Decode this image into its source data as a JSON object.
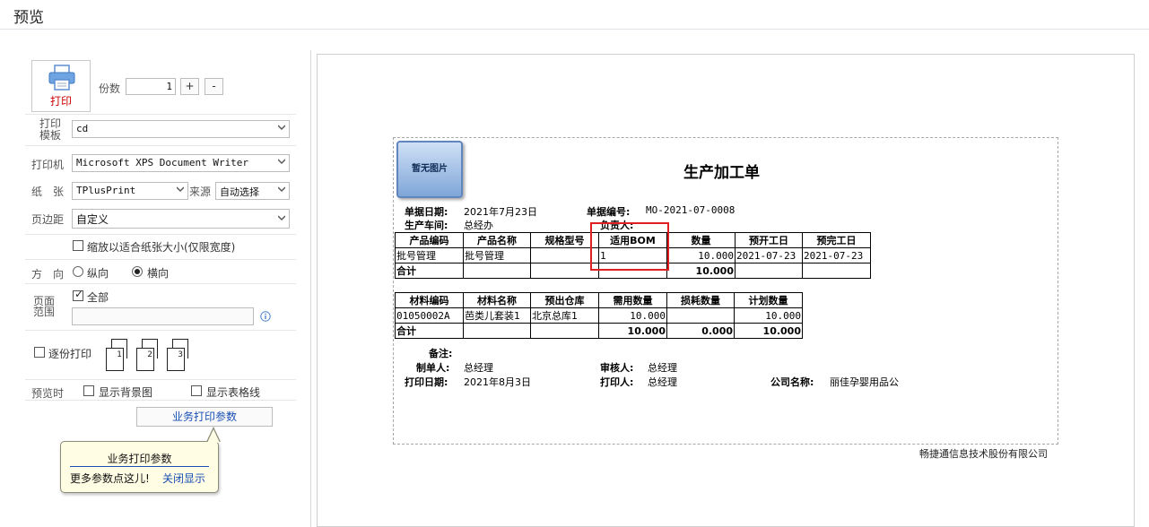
{
  "window": {
    "title": "预览"
  },
  "left": {
    "print_label": "打印",
    "copies_label": "份数",
    "copies_value": "1",
    "plus": "+",
    "minus": "-",
    "template_label_1": "打印",
    "template_label_2": "模板",
    "template_value": "cd",
    "printer_label": "打印机",
    "printer_value": "Microsoft XPS Document Writer",
    "paper_label": "纸　张",
    "paper_value": "TPlusPrint",
    "source_label": "来源",
    "source_value": "自动选择",
    "margin_label": "页边距",
    "margin_value": "自定义",
    "fit_label": "缩放以适合纸张大小(仅限宽度)",
    "fit_checked": false,
    "orient_label": "方　向",
    "portrait": "纵向",
    "landscape": "横向",
    "orientation": "landscape",
    "range_label_1": "页面",
    "range_label_2": "范围",
    "all_label": "全部",
    "all_checked": true,
    "range_value": "",
    "collate_label": "逐份打印",
    "collate_checked": false,
    "page_nums": [
      "1",
      "2",
      "3"
    ],
    "preview_label": "预览时",
    "bg_label": "显示背景图",
    "bg_checked": false,
    "grid_label": "显示表格线",
    "grid_checked": false,
    "biz_button": "业务打印参数",
    "tip_title": "业务打印参数",
    "tip_body": "更多参数点这儿!",
    "tip_close": "关闭显示"
  },
  "doc": {
    "no_image": "暂无图片",
    "title": "生产加工单",
    "date_label": "单据日期:",
    "date_value": "2021年7月23日",
    "code_label": "单据编号:",
    "code_value": "MO-2021-07-0008",
    "workshop_label": "生产车间:",
    "workshop_value": "总经办",
    "owner_label": "负责人:",
    "t1_headers": [
      "产品编码",
      "产品名称",
      "规格型号",
      "适用BOM",
      "数量",
      "预开工日",
      "预完工日"
    ],
    "t1_rows": [
      [
        "批号管理",
        "批号管理",
        "",
        "1",
        "10.000",
        "2021-07-23",
        "2021-07-23"
      ]
    ],
    "t1_total": [
      "合计",
      "",
      "",
      "",
      "10.000",
      "",
      ""
    ],
    "t2_headers": [
      "材料编码",
      "材料名称",
      "预出仓库",
      "需用数量",
      "损耗数量",
      "计划数量"
    ],
    "t2_rows": [
      [
        "01050002A",
        "芭类儿套装1",
        "北京总库1",
        "10.000",
        "",
        "10.000"
      ]
    ],
    "t2_total": [
      "合计",
      "",
      "",
      "10.000",
      "0.000",
      "10.000"
    ],
    "remark_label": "备注:",
    "maker_label": "制单人:",
    "maker_value": "总经理",
    "auditor_label": "审核人:",
    "auditor_value": "总经理",
    "print_date_label": "打印日期:",
    "print_date_value": "2021年8月3日",
    "printer_person_label": "打印人:",
    "printer_person_value": "总经理",
    "company_label": "公司名称:",
    "company_value": "丽佳孕婴用品公",
    "footer_company": "畅捷通信息技术股份有限公司"
  },
  "colors": {
    "accent_link": "#1a4fb5",
    "print_red": "#cc0000",
    "highlight_box": "#e02020"
  }
}
